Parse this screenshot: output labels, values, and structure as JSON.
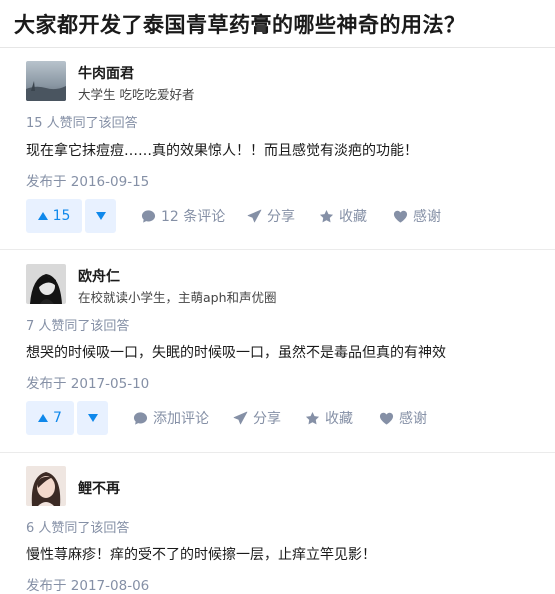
{
  "question": {
    "title": "大家都开发了泰国青草药膏的哪些神奇的用法？"
  },
  "answers": [
    {
      "author": {
        "name": "牛肉面君",
        "bio": "大学生 吃吃吃爱好者"
      },
      "votes_text": "15 人赞同了该回答",
      "content": "现在拿它抹痘痘……真的效果惊人！！而且感觉有淡疤的功能！",
      "date": "发布于 2016-09-15",
      "actions": {
        "upvote_count": "15",
        "comment": "12 条评论",
        "share": "分享",
        "collect": "收藏",
        "thanks": "感谢"
      }
    },
    {
      "author": {
        "name": "欧舟仁",
        "bio": "在校就读小学生，主萌aph和声优圈"
      },
      "votes_text": "7 人赞同了该回答",
      "content": "想哭的时候吸一口，失眠的时候吸一口，虽然不是毒品但真的有神效",
      "date": "发布于 2017-05-10",
      "actions": {
        "upvote_count": "7",
        "comment": "添加评论",
        "share": "分享",
        "collect": "收藏",
        "thanks": "感谢"
      }
    },
    {
      "author": {
        "name": "鲤不再",
        "bio": ""
      },
      "votes_text": "6 人赞同了该回答",
      "content": "慢性荨麻疹！痒的受不了的时候擦一层，止痒立竿见影！",
      "date": "发布于 2017-08-06"
    }
  ],
  "icons": {
    "upvote": "triangle-up-icon",
    "downvote": "triangle-down-icon",
    "comment": "speech-bubble-icon",
    "share": "paper-plane-icon",
    "collect": "star-icon",
    "thanks": "heart-icon"
  },
  "colors": {
    "accent": "#0f88eb",
    "vote_bg": "#e8f1ff",
    "meta_text": "#8590a6"
  }
}
